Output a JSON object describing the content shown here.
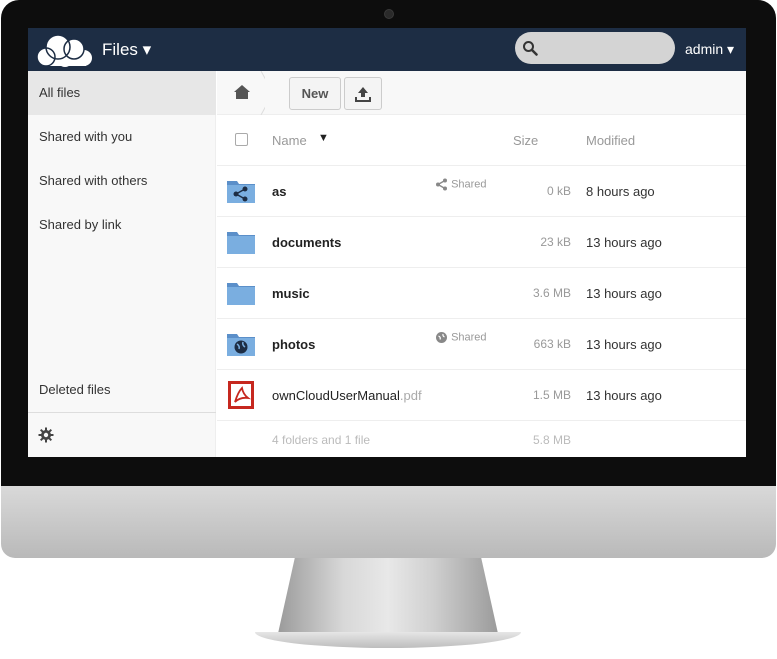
{
  "app": {
    "title": "Files ▾",
    "user": "admin ▾"
  },
  "search": {
    "placeholder": ""
  },
  "sidebar": {
    "items": [
      {
        "label": "All files"
      },
      {
        "label": "Shared with you"
      },
      {
        "label": "Shared with others"
      },
      {
        "label": "Shared by link"
      }
    ],
    "deleted": "Deleted files"
  },
  "toolbar": {
    "new_label": "New"
  },
  "table": {
    "headers": {
      "name": "Name",
      "sort": "▼",
      "size": "Size",
      "modified": "Modified"
    },
    "rows": [
      {
        "name": "as",
        "ext": "",
        "shared": "Shared",
        "size": "0 kB",
        "modified": "8 hours ago",
        "icon": "shared-folder-icon"
      },
      {
        "name": "documents",
        "ext": "",
        "shared": "",
        "size": "23 kB",
        "modified": "13 hours ago",
        "icon": "folder-icon"
      },
      {
        "name": "music",
        "ext": "",
        "shared": "",
        "size": "3.6 MB",
        "modified": "13 hours ago",
        "icon": "folder-icon"
      },
      {
        "name": "photos",
        "ext": "",
        "shared": "Shared",
        "size": "663 kB",
        "modified": "13 hours ago",
        "icon": "public-folder-icon"
      },
      {
        "name": "ownCloudUserManual",
        "ext": ".pdf",
        "shared": "",
        "size": "1.5 MB",
        "modified": "13 hours ago",
        "icon": "pdf-icon"
      }
    ],
    "summary": {
      "text": "4 folders and 1 file",
      "size": "5.8 MB"
    }
  },
  "colors": {
    "topbar": "#1d2d44",
    "folder": "#6fa0d6"
  }
}
